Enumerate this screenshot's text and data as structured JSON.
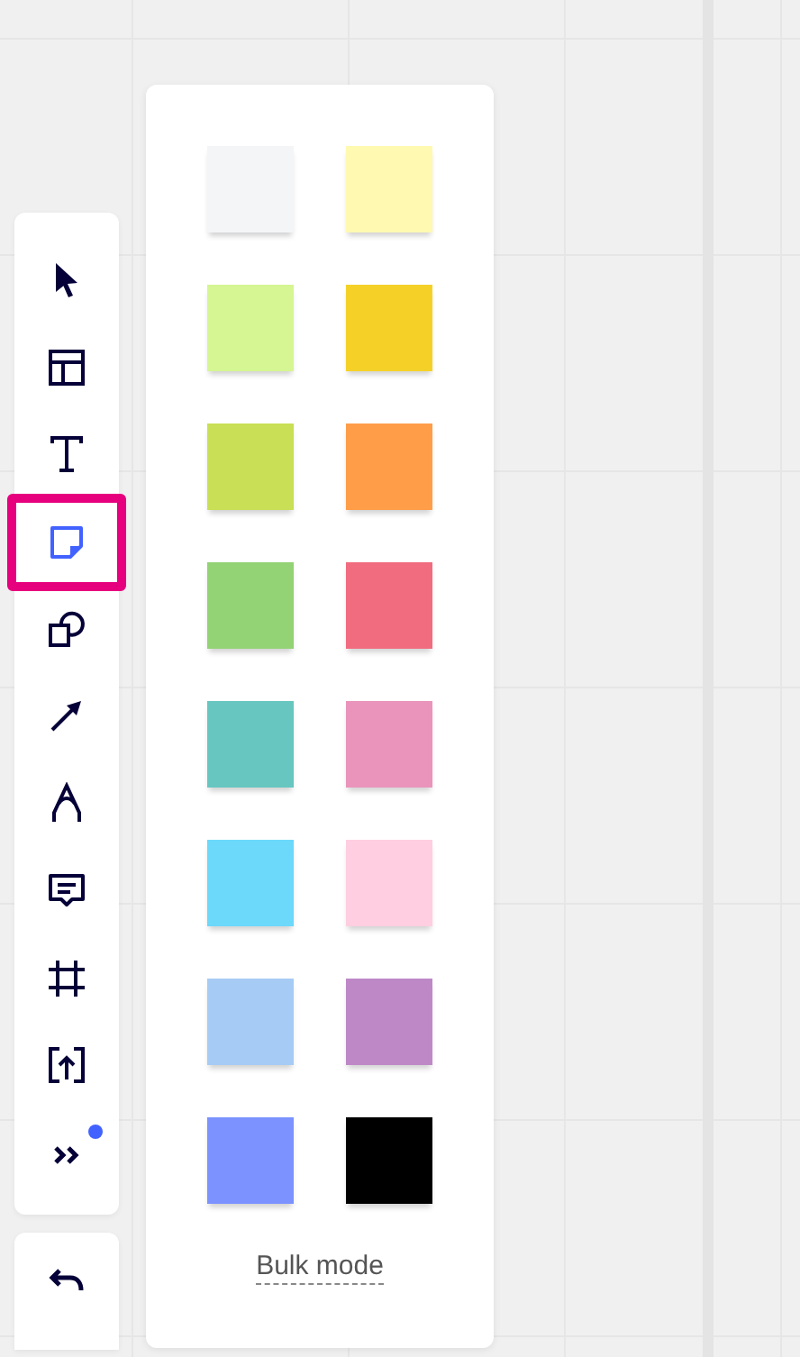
{
  "toolbar": {
    "tools": [
      {
        "kind": "select",
        "selected": false
      },
      {
        "kind": "template",
        "selected": false
      },
      {
        "kind": "text",
        "selected": false
      },
      {
        "kind": "sticky",
        "selected": true
      },
      {
        "kind": "shape",
        "selected": false
      },
      {
        "kind": "arrow",
        "selected": false
      },
      {
        "kind": "pen",
        "selected": false
      },
      {
        "kind": "comment",
        "selected": false
      },
      {
        "kind": "frame",
        "selected": false
      },
      {
        "kind": "upload",
        "selected": false
      },
      {
        "kind": "more",
        "selected": false,
        "badge": true
      }
    ]
  },
  "undo_bar": {
    "tools": [
      {
        "kind": "undo"
      }
    ]
  },
  "sticky_palette": {
    "colors": [
      {
        "color": "#f4f5f7"
      },
      {
        "color": "#fff9b1"
      },
      {
        "color": "#d5f692"
      },
      {
        "color": "#f5d128"
      },
      {
        "color": "#c9df56"
      },
      {
        "color": "#ff9d48"
      },
      {
        "color": "#93d275"
      },
      {
        "color": "#f16c7f"
      },
      {
        "color": "#67c6c0"
      },
      {
        "color": "#ea94bb"
      },
      {
        "color": "#6cd8fa"
      },
      {
        "color": "#ffcee0"
      },
      {
        "color": "#a6ccf5"
      },
      {
        "color": "#be88c7"
      },
      {
        "color": "#7b92ff"
      },
      {
        "color": "#000000"
      }
    ],
    "bulk_mode_label": "Bulk mode"
  }
}
